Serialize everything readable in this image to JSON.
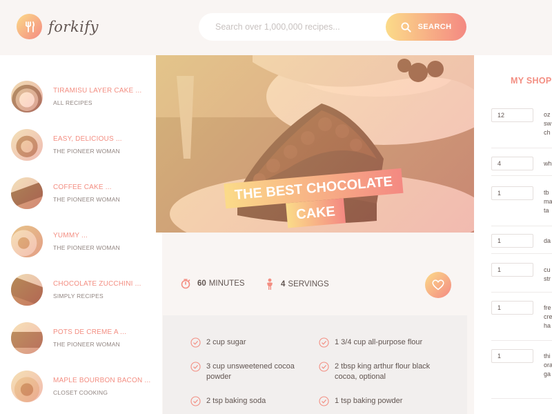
{
  "header": {
    "logo_text": "forkify",
    "search_placeholder": "Search over 1,000,000 recipes...",
    "search_button_label": "SEARCH"
  },
  "results": [
    {
      "title": "TIRAMISU LAYER CAKE ...",
      "publisher": "ALL RECIPES"
    },
    {
      "title": "EASY, DELICIOUS ...",
      "publisher": "THE PIONEER WOMAN"
    },
    {
      "title": "COFFEE CAKE ...",
      "publisher": "THE PIONEER WOMAN"
    },
    {
      "title": "YUMMY ...",
      "publisher": "THE PIONEER WOMAN"
    },
    {
      "title": "CHOCOLATE ZUCCHINI ...",
      "publisher": "SIMPLY RECIPES"
    },
    {
      "title": "POTS DE CREME A ...",
      "publisher": "THE PIONEER WOMAN"
    },
    {
      "title": "MAPLE BOURBON BACON ...",
      "publisher": "CLOSET COOKING"
    }
  ],
  "recipe": {
    "title_line1": "THE BEST CHOCOLATE",
    "title_line2": "CAKE",
    "minutes": "60",
    "minutes_label": "MINUTES",
    "servings": "4",
    "servings_label": "SERVINGS",
    "ingredients": [
      {
        "line1": "2 cup sugar",
        "line2": ""
      },
      {
        "line1": "1 3/4 cup all-purpose flour",
        "line2": ""
      },
      {
        "line1": "3 cup unsweetened cocoa",
        "line2": "powder"
      },
      {
        "line1": "2 tbsp king arthur flour black",
        "line2": "cocoa, optional"
      },
      {
        "line1": "2 tsp baking soda",
        "line2": ""
      },
      {
        "line1": "1 tsp baking powder",
        "line2": ""
      }
    ]
  },
  "shopping": {
    "title": "MY SHOPPING LIST",
    "items": [
      {
        "qty": "12",
        "desc": [
          "oz",
          "sw",
          "ch"
        ]
      },
      {
        "qty": "4",
        "desc": [
          "wh"
        ]
      },
      {
        "qty": "1",
        "desc": [
          "tb",
          "ma",
          "ta"
        ]
      },
      {
        "qty": "1",
        "desc": [
          "da"
        ]
      },
      {
        "qty": "1",
        "desc": [
          "cu",
          "str"
        ]
      },
      {
        "qty": "1",
        "desc": [
          "fre",
          "cre",
          "ha"
        ]
      },
      {
        "qty": "1",
        "desc": [
          "thi",
          "ora",
          "ga"
        ]
      }
    ]
  },
  "colors": {
    "accent_start": "#fbdb89",
    "accent_end": "#f48982",
    "accent_text": "#f38e82",
    "text": "#615551",
    "background": "#f9f5f3"
  }
}
